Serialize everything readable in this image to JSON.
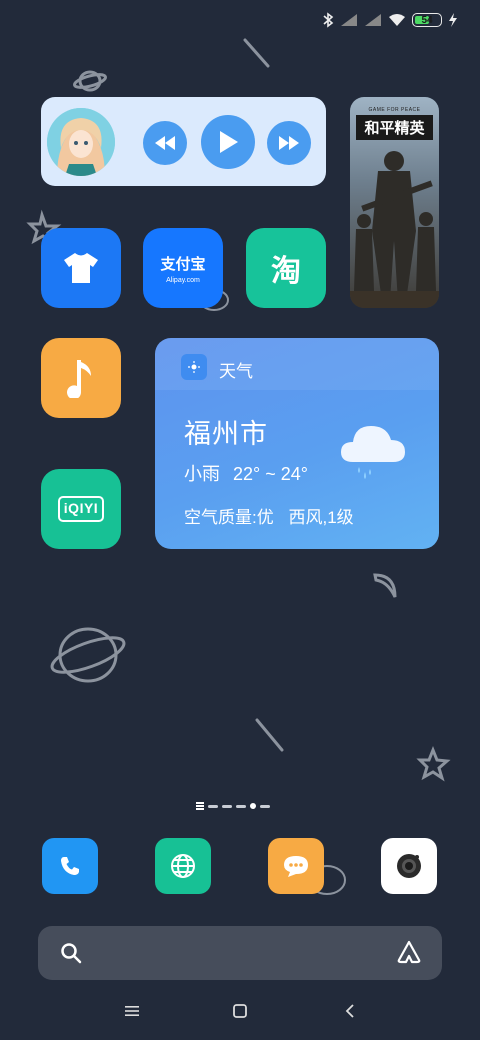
{
  "status_bar": {
    "battery_level": "54",
    "icons": [
      "bluetooth-icon",
      "signal-icon",
      "signal-icon",
      "wifi-icon",
      "battery-icon",
      "charging-icon"
    ]
  },
  "music_widget": {
    "buttons": [
      "rewind-icon",
      "play-icon",
      "fast-forward-icon"
    ]
  },
  "game_widget": {
    "tag": "GAME FOR PEACE",
    "title": "和平精英"
  },
  "apps": {
    "theme": {
      "icon": "tshirt-icon",
      "color": "#1c78f5"
    },
    "alipay": {
      "text": "支付宝",
      "sub": "Alipay.com",
      "color": "#1677ff"
    },
    "taobao": {
      "text": "淘",
      "color": "#17c39a"
    },
    "music": {
      "icon": "music-note-icon",
      "color": "#f7aa44"
    },
    "iqiyi": {
      "text": "iQIYI",
      "color": "#17c195"
    }
  },
  "weather": {
    "title": "天气",
    "city": "福州市",
    "condition": "小雨",
    "temp": "22° ~ 24°",
    "air": "空气质量:优",
    "wind": "西风,1级"
  },
  "page_indicator": {
    "count": 6,
    "active_index": 4
  },
  "dock": {
    "phone": {
      "icon": "phone-icon",
      "color": "#2196f3"
    },
    "browser": {
      "icon": "globe-icon",
      "color": "#17c195"
    },
    "messages": {
      "icon": "chat-bubble-icon",
      "color": "#f7aa44"
    },
    "camera": {
      "icon": "camera-icon",
      "color": "#ffffff"
    }
  },
  "search_bar": {
    "icon": "search-icon",
    "right_icon": "assistant-icon"
  },
  "nav_bar": [
    "menu-icon",
    "home-icon",
    "back-icon"
  ]
}
